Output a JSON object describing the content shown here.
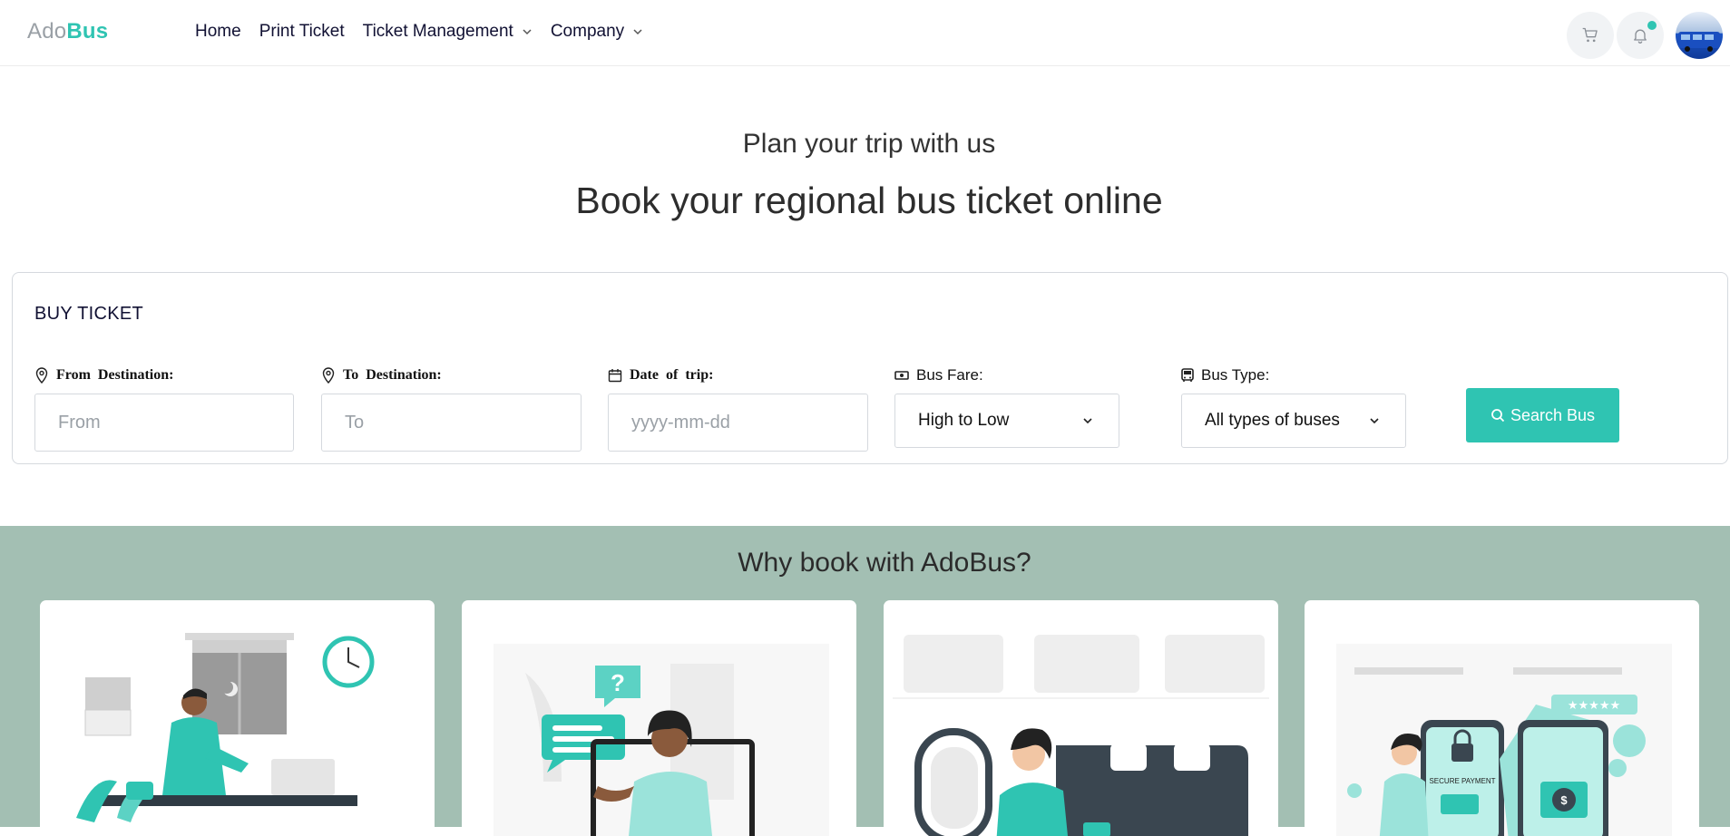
{
  "brand": {
    "part1": "Ado",
    "part2": "Bus"
  },
  "nav": {
    "items": [
      {
        "label": "Home",
        "dropdown": false
      },
      {
        "label": "Print Ticket",
        "dropdown": false
      },
      {
        "label": "Ticket Management",
        "dropdown": true
      },
      {
        "label": "Company",
        "dropdown": true
      }
    ],
    "cart_icon": "cart-icon",
    "bell_icon": "bell-icon"
  },
  "hero": {
    "subtitle": "Plan your trip with us",
    "title": "Book your regional bus ticket online"
  },
  "ticket": {
    "title": "BUY TICKET",
    "from": {
      "label": "From Destination:",
      "placeholder": "From"
    },
    "to": {
      "label": "To Destination:",
      "placeholder": "To"
    },
    "date": {
      "label": "Date of trip:",
      "placeholder": "yyyy-mm-dd"
    },
    "fare": {
      "label": "Bus Fare:",
      "value": "High to Low"
    },
    "type": {
      "label": "Bus Type:",
      "value": "All types of buses"
    },
    "search_label": "Search Bus"
  },
  "why": {
    "title": "Why book with AdoBus?",
    "cards": [
      "booking-illustration",
      "support-illustration",
      "travel-illustration",
      "payment-illustration"
    ],
    "payment_caption": "SECURE PAYMENT"
  },
  "colors": {
    "accent": "#2fc4b2",
    "section_bg": "#a3bfb3",
    "nav_text": "#111133"
  }
}
